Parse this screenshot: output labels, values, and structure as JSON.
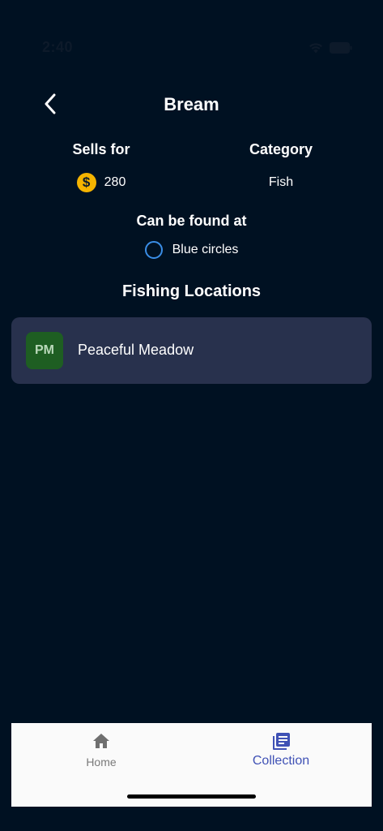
{
  "status_bar": {
    "time": "2:40"
  },
  "header": {
    "title": "Bream"
  },
  "info": {
    "sells_for_label": "Sells for",
    "sells_for_value": "280",
    "category_label": "Category",
    "category_value": "Fish"
  },
  "found": {
    "heading": "Can be found at",
    "value": "Blue circles"
  },
  "locations": {
    "heading": "Fishing Locations",
    "items": [
      {
        "abbr": "PM",
        "name": "Peaceful Meadow"
      }
    ]
  },
  "nav": {
    "home_label": "Home",
    "collection_label": "Collection"
  },
  "colors": {
    "background": "#001122",
    "card": "#28314d",
    "accent": "#3f51b5",
    "coin": "#f5b400",
    "circle": "#3a8ee6",
    "avatar": "#1e5e22"
  }
}
